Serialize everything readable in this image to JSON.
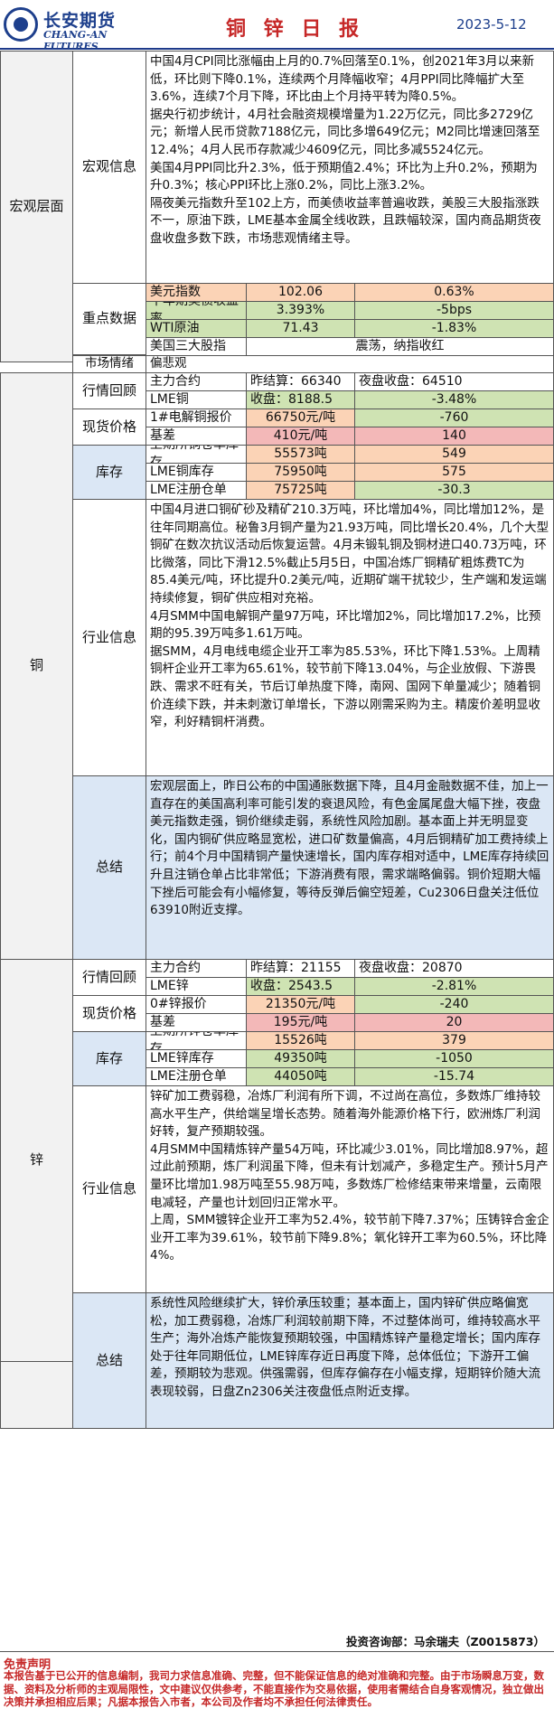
{
  "header": {
    "logo_cn": "长安期货",
    "logo_en": "CHANG-AN FUTURES",
    "title": "铜 锌 日 报",
    "date": "2023-5-12"
  },
  "macro": {
    "section": "宏观层面",
    "info_label": "宏观信息",
    "info_text": "中国4月CPI同比涨幅由上月的0.7%回落至0.1%，创2021年3月以来新低，环比则下降0.1%，连续两个月降幅收窄；4月PPI同比降幅扩大至3.6%，连续7个月下降，环比由上个月持平转为降0.5%。\n据央行初步统计，4月社会融资规模增量为1.22万亿元，同比多2729亿元；新增人民币贷款7188亿元，同比多增649亿元；M2同比增速回落至12.4%；4月人民币存款减少4609亿元，同比多减5524亿元。\n美国4月PPI同比升2.3%，低于预期值2.4%；环比为上升0.2%，预期为升0.3%；核心PPI环比上涨0.2%，同比上涨3.2%。\n隔夜美元指数升至102上方，而美债收益率普遍收跌，美股三大股指涨跌不一，原油下跌，LME基本金属全线收跌，且跌幅较深，国内商品期货夜盘收盘多数下跌，市场悲观情绪主导。",
    "key_label": "重点数据",
    "key_rows": [
      {
        "name": "美元指数",
        "value": "102.06",
        "change": "0.63%"
      },
      {
        "name": "十年期美债收益率",
        "value": "3.393%",
        "change": "-5bps"
      },
      {
        "name": "WTI原油",
        "value": "71.43",
        "change": "-1.83%"
      },
      {
        "name": "美国三大股指",
        "value": "震荡，纳指收红"
      }
    ],
    "sentiment_label": "市场情绪",
    "sentiment_value": "偏悲观"
  },
  "copper": {
    "section": "铜",
    "review_label": "行情回顾",
    "review": {
      "contract": "主力合约",
      "settle": "昨结算：66340",
      "night": "夜盘收盘：64510",
      "lme": "LME铜",
      "lme_close": "收盘：8188.5",
      "lme_change": "-3.48%"
    },
    "spot_label": "现货价格",
    "spot": {
      "name": "1#电解铜报价",
      "price": "66750元/吨",
      "change": "-760",
      "basis_name": "基差",
      "basis": "410元/吨",
      "basis_change": "140"
    },
    "stock_label": "库存",
    "stocks": [
      {
        "name": "上期所铜仓单库存",
        "value": "55573吨",
        "change": "549"
      },
      {
        "name": "LME铜库存",
        "value": "75950吨",
        "change": "575"
      },
      {
        "name": "LME注册仓单",
        "value": "75725吨",
        "change": "-30.3"
      }
    ],
    "industry_label": "行业信息",
    "industry_text": "中国4月进口铜矿砂及精矿210.3万吨，环比增加4%，同比增加12%，是往年同期高位。秘鲁3月铜产量为21.93万吨，同比增长20.4%，几个大型铜矿在数次抗议活动后恢复运营。4月未锻轧铜及铜材进口40.73万吨，环比微落，同比下滑12.5%截止5月5日，中国冶炼厂铜精矿粗炼费TC为85.4美元/吨，环比提升0.2美元/吨，近期矿端干扰较少，生产端和发运端持续修复，铜矿供应相对充裕。\n4月SMM中国电解铜产量97万吨，环比增加2%，同比增加17.2%，比预期的95.39万吨多1.61万吨。\n据SMM，4月电线电缆企业开工率为85.53%，环比下降1.53%。上周精铜杆企业开工率为65.61%，较节前下降13.04%，与企业放假、下游畏跌、需求不旺有关，节后订单热度下降，南网、国网下单量减少；随着铜价连续下跌，并未刺激订单增长，下游以刚需采购为主。精废价差明显收窄，利好精铜杆消费。",
    "summary_label": "总结",
    "summary_text": "宏观层面上，昨日公布的中国通胀数据下降，且4月金融数据不佳，加上一直存在的美国高利率可能引发的衰退风险，有色金属尾盘大幅下挫，夜盘美元指数走强，铜价继续走弱，系统性风险加剧。基本面上并无明显变化，国内铜矿供应略显宽松，进口矿数量偏高，4月后铜精矿加工费持续上行；前4个月中国精铜产量快速增长，国内库存相对适中，LME库存持续回升且注销仓单占比非常低；下游消费有限，需求端略偏弱。铜价短期大幅下挫后可能会有小幅修复，等待反弹后偏空短差，Cu2306日盘关注低位63910附近支撑。"
  },
  "zinc": {
    "section": "锌",
    "review_label": "行情回顾",
    "review": {
      "contract": "主力合约",
      "settle": "昨结算：21155",
      "night": "夜盘收盘：20870",
      "lme": "LME锌",
      "lme_close": "收盘：2543.5",
      "lme_change": "-2.81%"
    },
    "spot_label": "现货价格",
    "spot": {
      "name": "0#锌报价",
      "price": "21350元/吨",
      "change": "-240",
      "basis_name": "基差",
      "basis": "195元/吨",
      "basis_change": "20"
    },
    "stock_label": "库存",
    "stocks": [
      {
        "name": "上期所锌仓单库存",
        "value": "15526吨",
        "change": "379"
      },
      {
        "name": "LME锌库存",
        "value": "49350吨",
        "change": "-1050"
      },
      {
        "name": "LME注册仓单",
        "value": "44050吨",
        "change": "-15.74"
      }
    ],
    "industry_label": "行业信息",
    "industry_text": "锌矿加工费弱稳，冶炼厂利润有所下调，不过尚在高位，多数炼厂维持较高水平生产，供给端呈增长态势。随着海外能源价格下行，欧洲炼厂利润好转，复产预期较强。\n4月SMM中国精炼锌产量54万吨，环比减少3.01%，同比增加8.97%，超过此前预期，炼厂利润虽下降，但未有计划减产，多稳定生产。预计5月产量环比增加1.98万吨至55.98万吨，多数炼厂检修结束带来增量，云南限电减轻，产量也计划回归正常水平。\n上周，SMM镀锌企业开工率为52.4%，较节前下降7.37%；压铸锌合金企业开工率为39.61%，较节前下降9.8%；氧化锌开工率为60.5%，环比降4%。",
    "summary_label": "总结",
    "summary_text": "系统性风险继续扩大，锌价承压较重；基本面上，国内锌矿供应略偏宽松，加工费弱稳，冶炼厂利润较前期下降，不过整体尚可，维持较高水平生产；海外冶炼产能恢复预期较强，中国精炼锌产量稳定增长；国内库存处于往年同期低位，LME锌库存近日再度下降，总体低位；下游开工偏差，预期较为悲观。供强需弱，但库存偏存在小幅支撑，短期锌价随大流表现较弱，日盘Zn2306关注夜盘低点附近支撑。"
  },
  "footer": {
    "analyst": "投资咨询部：马余瑞夫（Z0015873）",
    "disclaimer_title": "免责声明",
    "disclaimer_text": "本报告基于已公开的信息编制，我司力求信息准确、完整，但不能保证信息的绝对准确和完整。由于市场瞬息万变，数据、资料及分析师的主观局限性，文中建议仅供参考，不能直接作为交易依据，使用者需结合自身客观情况，独立做出决策并承担相应后果；凡据本报告入市者，本公司及作者均不承担任何法律责任。"
  }
}
